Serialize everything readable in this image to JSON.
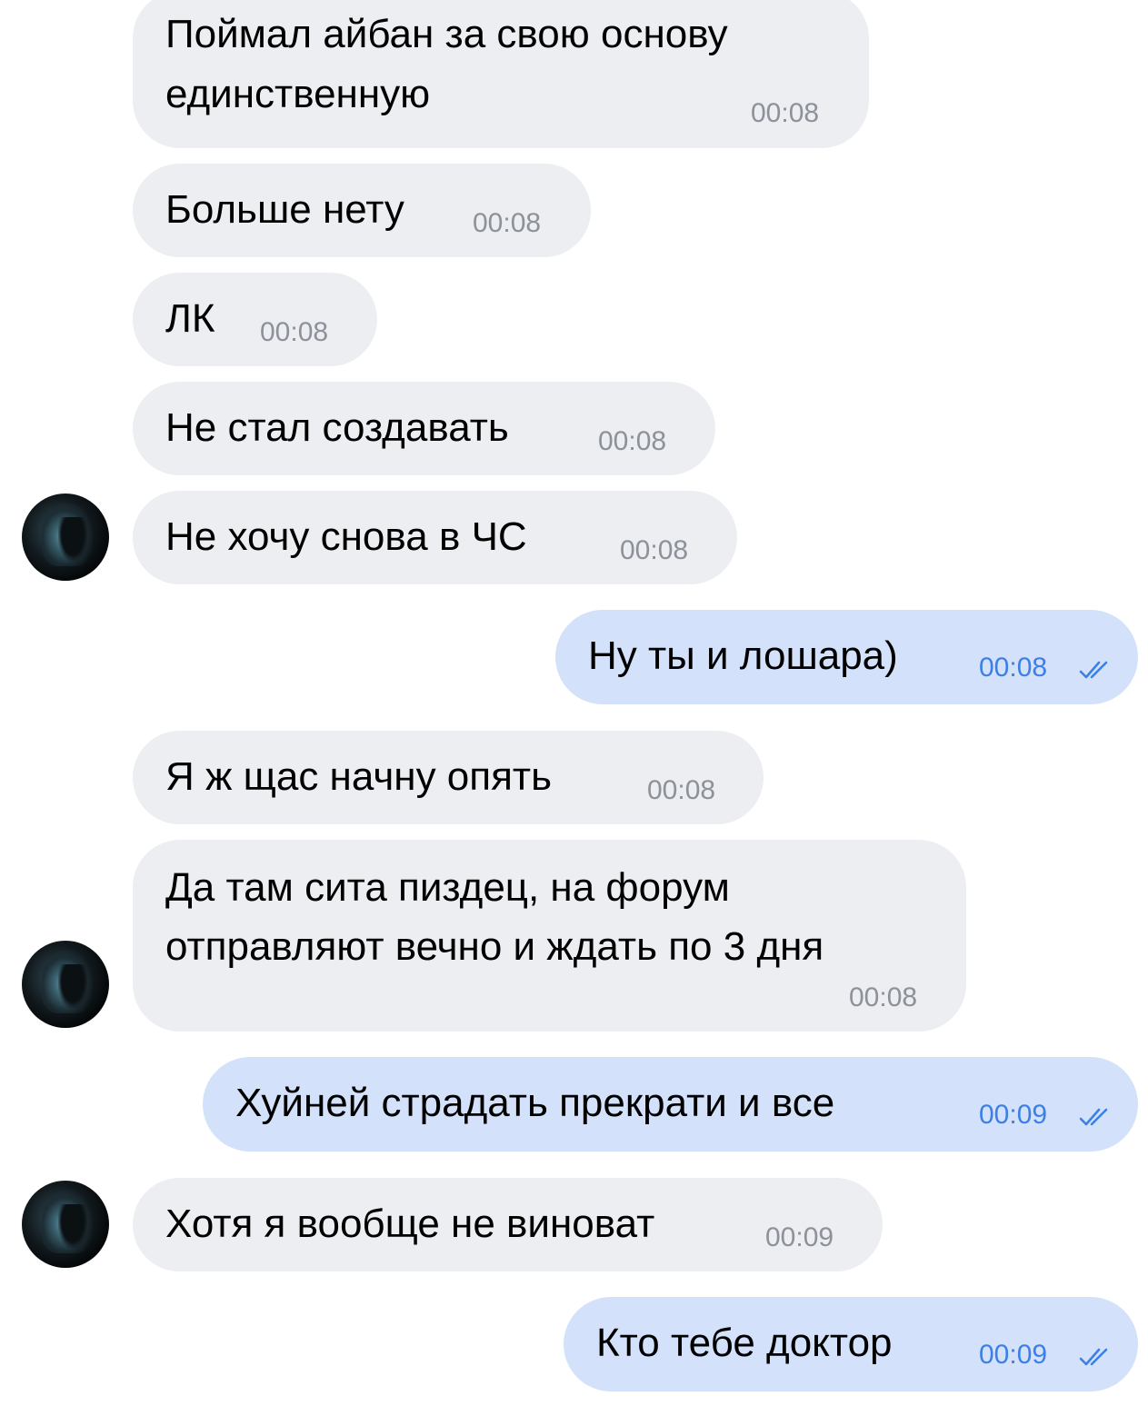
{
  "chat": {
    "messages": [
      {
        "direction": "in",
        "lines": [
          "Поймал айбан за свою основу",
          "единственную"
        ],
        "time": "00:08"
      },
      {
        "direction": "in",
        "text": "Больше нету",
        "time": "00:08"
      },
      {
        "direction": "in",
        "text": "ЛК",
        "time": "00:08"
      },
      {
        "direction": "in",
        "text": "Не стал создавать",
        "time": "00:08"
      },
      {
        "direction": "in",
        "text": "Не хочу снова в ЧС",
        "time": "00:08",
        "avatar": "sender-avatar"
      },
      {
        "direction": "out",
        "text": "Ну ты и лошара)",
        "time": "00:08",
        "status": "read-double-check-icon"
      },
      {
        "direction": "in",
        "text": "Я ж щас начну опять",
        "time": "00:08"
      },
      {
        "direction": "in",
        "lines": [
          "Да там сита пиздец, на форум",
          "отправляют вечно и ждать по 3 дня"
        ],
        "time": "00:08",
        "avatar": "sender-avatar"
      },
      {
        "direction": "out",
        "text": "Хуйней страдать прекрати и все",
        "time": "00:09",
        "status": "read-double-check-icon"
      },
      {
        "direction": "in",
        "text": "Хотя я вообще не виноват",
        "time": "00:09",
        "avatar": "sender-avatar"
      },
      {
        "direction": "out",
        "text": "Кто тебе доктор",
        "time": "00:09",
        "status": "read-double-check-icon"
      }
    ]
  },
  "colors": {
    "background": "#ffffff",
    "incoming_bubble": "#eceef2",
    "outgoing_bubble": "#d3e2fa",
    "incoming_time": "#8d9199",
    "outgoing_time": "#3c80e6",
    "read_check": "#3c80e6"
  }
}
